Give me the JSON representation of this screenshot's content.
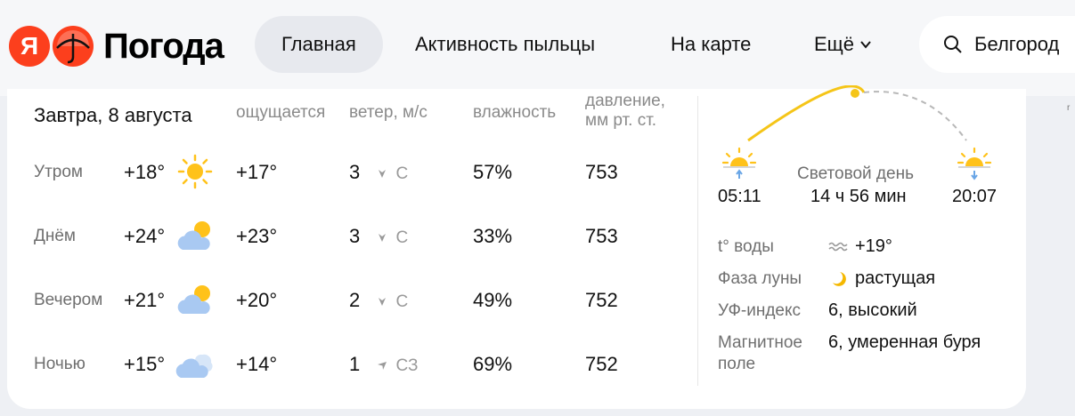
{
  "app": {
    "logo_letter": "Я",
    "title": "Погода"
  },
  "nav": {
    "items": [
      {
        "label": "Главная",
        "active": true
      },
      {
        "label": "Активность пыльцы",
        "active": false
      },
      {
        "label": "На карте",
        "active": false
      },
      {
        "label": "Ещё",
        "active": false
      }
    ]
  },
  "search": {
    "value": "Белгород"
  },
  "forecast": {
    "title": "Завтра, 8 августа",
    "columns": {
      "feels": "ощущается",
      "wind": "ветер, м/с",
      "humidity": "влажность",
      "pressure_line1": "давление,",
      "pressure_line2": "мм рт. ст."
    },
    "rows": [
      {
        "period": "Утром",
        "temp": "+18°",
        "icon": "sun-icon",
        "feels": "+17°",
        "wind_speed": "3",
        "wind_dir": "С",
        "humidity": "57%",
        "pressure": "753"
      },
      {
        "period": "Днём",
        "temp": "+24°",
        "icon": "partly-cloudy-icon",
        "feels": "+23°",
        "wind_speed": "3",
        "wind_dir": "С",
        "humidity": "33%",
        "pressure": "753"
      },
      {
        "period": "Вечером",
        "temp": "+21°",
        "icon": "partly-cloudy-icon",
        "feels": "+20°",
        "wind_speed": "2",
        "wind_dir": "С",
        "humidity": "49%",
        "pressure": "752"
      },
      {
        "period": "Ночью",
        "temp": "+15°",
        "icon": "cloudy-icon",
        "feels": "+14°",
        "wind_speed": "1",
        "wind_dir": "СЗ",
        "humidity": "69%",
        "pressure": "752"
      }
    ]
  },
  "sun": {
    "sunrise": "05:11",
    "sunset": "20:07",
    "daylight_label": "Световой день",
    "daylight_value": "14 ч 56 мин"
  },
  "details": [
    {
      "label": "t° воды",
      "value": "+19°",
      "icon": "water-waves-icon"
    },
    {
      "label": "Фаза луны",
      "value": "растущая",
      "icon": "moon-icon"
    },
    {
      "label": "УФ-индекс",
      "value": "6, высокий"
    },
    {
      "label": "Магнитное поле",
      "value": "6, умеренная буря"
    }
  ],
  "colors": {
    "brand_red": "#fc3f1d",
    "sun_yellow": "#ffc21a",
    "cloud_blue": "#a9c9f2",
    "arc_yellow": "#f5c518",
    "nav_active_bg": "#e7e9ee"
  }
}
